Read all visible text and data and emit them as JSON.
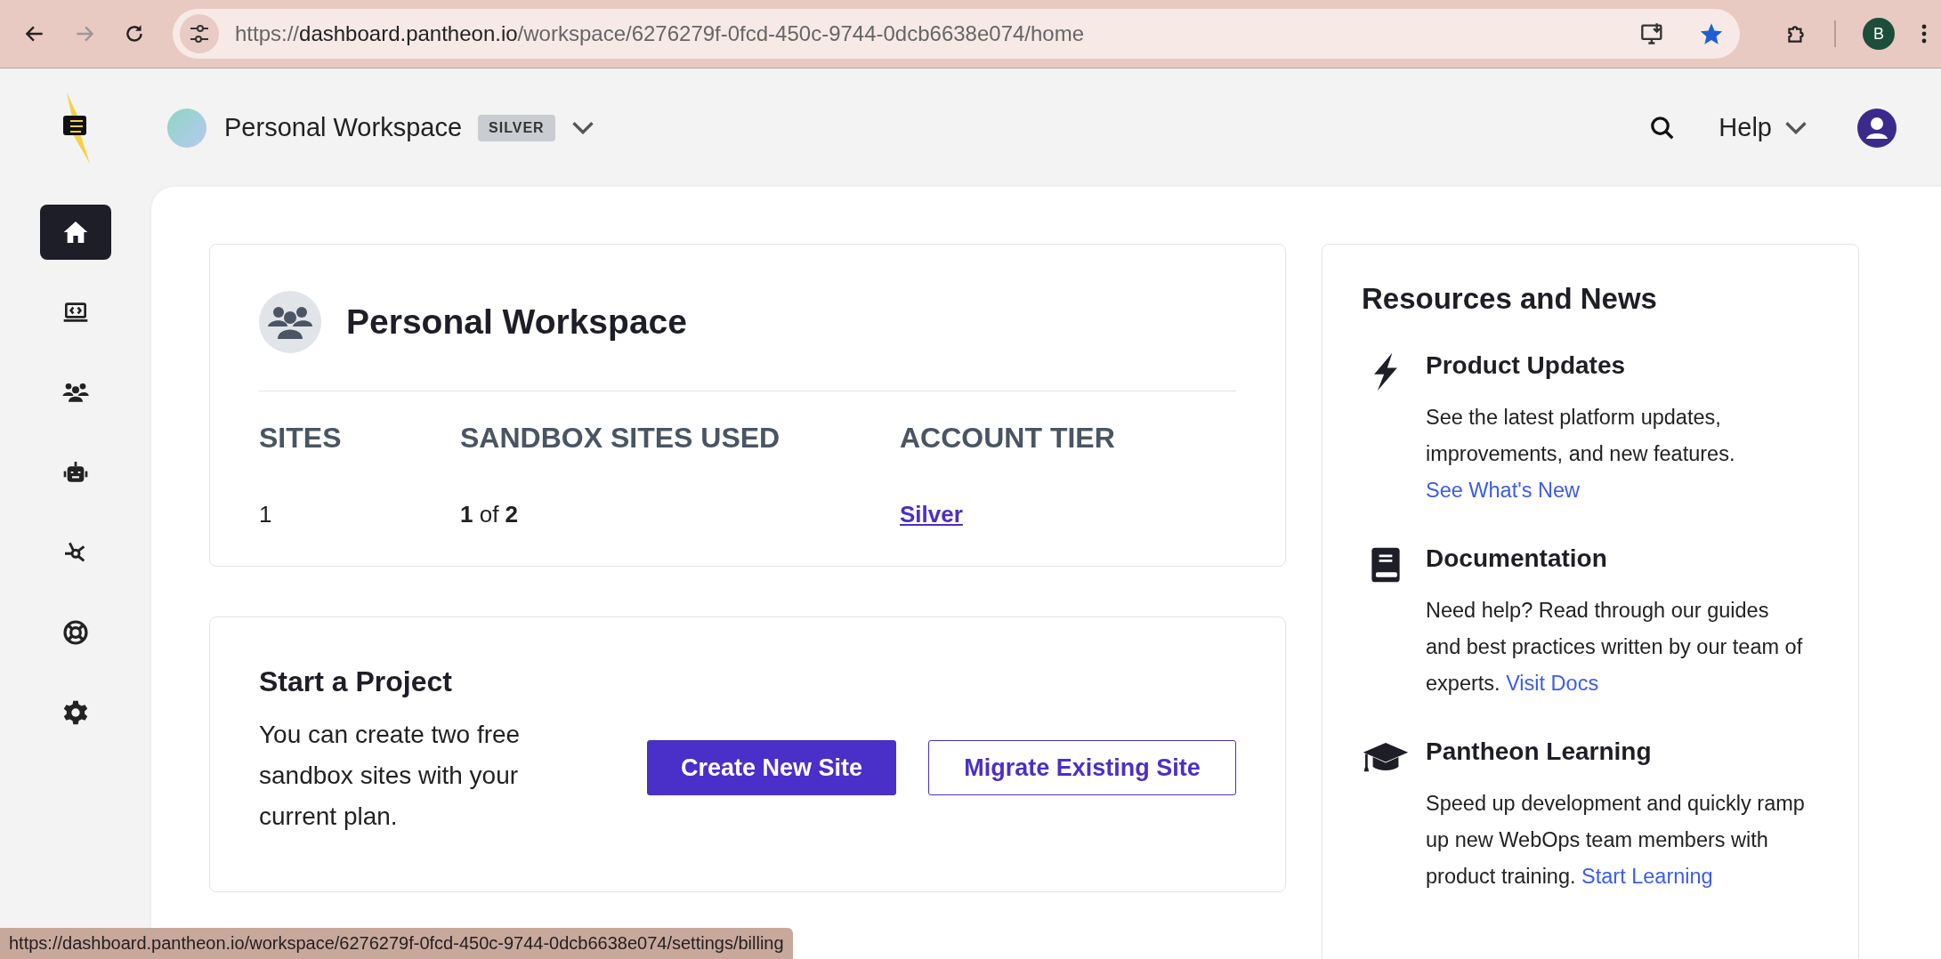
{
  "browser": {
    "url": {
      "scheme": "https://",
      "host": "dashboard.pantheon.io",
      "path": "/workspace/6276279f-0fcd-450c-9744-0dcb6638e074/home"
    },
    "profile_initial": "B"
  },
  "header": {
    "workspace_name": "Personal Workspace",
    "tier_badge": "SILVER",
    "help_label": "Help"
  },
  "sidebar": {
    "items": [
      {
        "kind": "home",
        "selected": true
      },
      {
        "kind": "sites",
        "selected": false
      },
      {
        "kind": "team",
        "selected": false
      },
      {
        "kind": "robot",
        "selected": false
      },
      {
        "kind": "network",
        "selected": false
      },
      {
        "kind": "support",
        "selected": false
      },
      {
        "kind": "settings",
        "selected": false
      }
    ]
  },
  "workspace_card": {
    "title": "Personal Workspace",
    "stats": [
      {
        "label": "SITES",
        "kind": "plain",
        "value": "1"
      },
      {
        "label": "SANDBOX SITES USED",
        "kind": "fraction",
        "used": "1",
        "joiner": "of",
        "total": "2"
      },
      {
        "label": "ACCOUNT TIER",
        "kind": "link",
        "value": "Silver"
      }
    ]
  },
  "project_card": {
    "title": "Start a Project",
    "description": "You can create two free sandbox sites with your current plan.",
    "buttons": [
      {
        "label": "Create New Site",
        "kind": "primary"
      },
      {
        "label": "Migrate Existing Site",
        "kind": "secondary"
      }
    ]
  },
  "resources": {
    "title": "Resources and News",
    "items": [
      {
        "kind": "bolt",
        "title": "Product Updates",
        "body": "See the latest platform updates, improvements, and new features.",
        "link": "See What's New"
      },
      {
        "kind": "book",
        "title": "Documentation",
        "body": "Need help? Read through our guides and best practices written by our team of experts.",
        "link": "Visit Docs"
      },
      {
        "kind": "cap",
        "title": "Pantheon Learning",
        "body": "Speed up development and quickly ramp up new WebOps team members with product training.",
        "link": "Start Learning"
      }
    ]
  },
  "status_bar": {
    "url": "https://dashboard.pantheon.io/workspace/6276279f-0fcd-450c-9744-0dcb6638e074/settings/billing"
  }
}
